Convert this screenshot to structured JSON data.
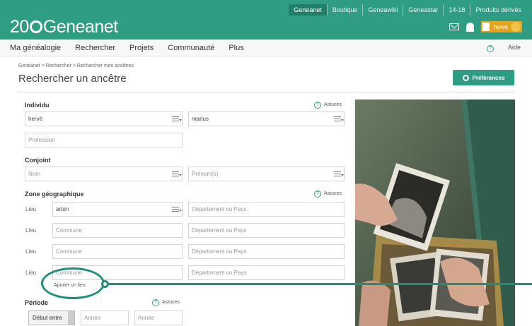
{
  "topbar": {
    "tabs": [
      "Geneanet",
      "Boutique",
      "Geneawiki",
      "Geneastar",
      "14-18",
      "Produits dérivés"
    ],
    "logo": {
      "prefix": "20",
      "name": "Geneanet"
    },
    "user_name": "hervé"
  },
  "nav": {
    "items": [
      "Ma généalogie",
      "Rechercher",
      "Projets",
      "Communauté",
      "Plus"
    ],
    "help": "Aide"
  },
  "breadcrumb": "Geneanet > Rechercher > Rechercher mes ancêtres",
  "page_title": "Rechercher un ancêtre",
  "preferences_label": "Préférences",
  "tips_label": "Astuces",
  "individu": {
    "label": "Individu",
    "lastname": "hervé",
    "firstname": "marius",
    "profession_placeholder": "Profession"
  },
  "conjoint": {
    "label": "Conjoint",
    "lastname_placeholder": "Nom",
    "firstname_placeholder": "Prénom(s)"
  },
  "zone": {
    "label": "Zone géographique",
    "lieu_label": "Lieu",
    "rows": [
      {
        "commune": "arton",
        "departement": "Département ou Pays"
      },
      {
        "commune": "Commune",
        "departement": "Département ou Pays"
      },
      {
        "commune": "Commune",
        "departement": "Département ou Pays"
      },
      {
        "commune": "Commune",
        "departement": "Département ou Pays"
      }
    ],
    "add_place": "Ajouter un lieu"
  },
  "periode": {
    "label": "Période",
    "select_value": "Début entre",
    "year1_placeholder": "Année",
    "year2_placeholder": "Année"
  }
}
